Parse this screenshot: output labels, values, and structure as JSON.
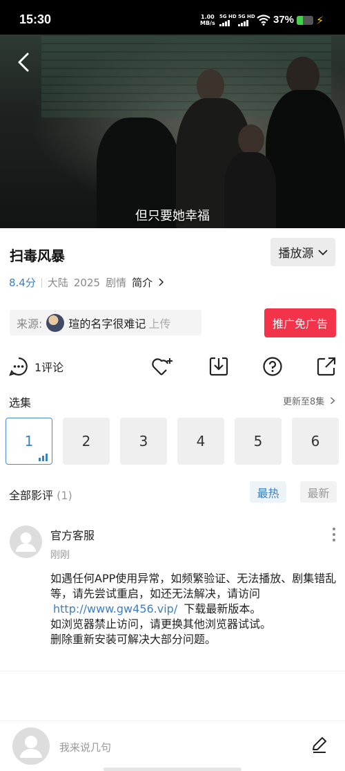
{
  "status_bar": {
    "time": "15:30",
    "net_speed_value": "1.00",
    "net_speed_unit": "MB/s",
    "sim1_label": "5G HD",
    "sim2_label": "5G HD",
    "battery_percent": "37%",
    "battery_level": 0.37,
    "battery_color": "#3fd24a"
  },
  "video": {
    "subtitle": "但只要她幸福",
    "back_icon": "chevron-left-icon"
  },
  "show": {
    "title": "扫毒风暴",
    "source_button": "播放源",
    "score": "8.4分",
    "region": "大陆",
    "year": "2025",
    "genre": "剧情",
    "intro_link": "简介"
  },
  "uploader": {
    "label": "来源:",
    "name": "瑄的名字很难记",
    "suffix": "上传"
  },
  "ad_button": "推广免广告",
  "actions": {
    "comment_count": "1评论",
    "icons": [
      "comment-icon",
      "favorite-add-icon",
      "download-icon",
      "help-icon",
      "share-icon"
    ]
  },
  "episodes": {
    "title": "选集",
    "update_status": "更新至8集",
    "items": [
      "1",
      "2",
      "3",
      "4",
      "5",
      "6"
    ],
    "active_index": 0
  },
  "reviews": {
    "title": "全部影评",
    "count": "(1)",
    "sort_hot": "最热",
    "sort_new": "最新"
  },
  "comment": {
    "author": "官方客服",
    "time": "刚刚",
    "line1": "如遇任何APP使用异常，如频繁验证、无法播放、剧集错乱等，请先尝试重启，如还无法解决，请访问",
    "link": "http://www.gw456.vip/",
    "line2": "下载最新版本。",
    "line3": "如浏览器禁止访问，请更换其他浏览器试试。",
    "line4": "删除重新安装可解决大部分问题。"
  },
  "composer": {
    "placeholder": "我来说几句"
  },
  "colors": {
    "accent_blue": "#3b7fc4",
    "ad_red": "#f2334a"
  }
}
